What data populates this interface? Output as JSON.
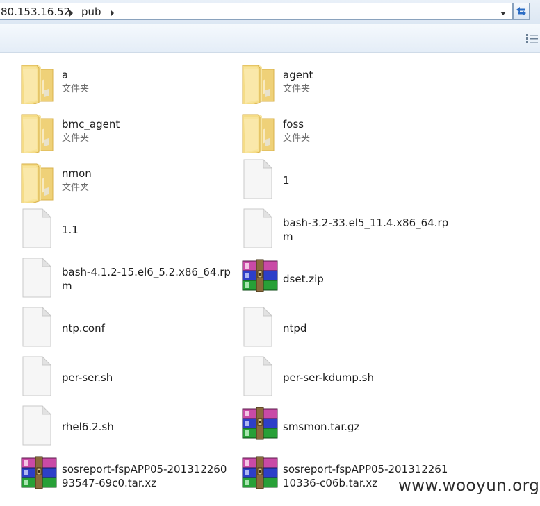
{
  "address_bar": {
    "segments": [
      "80.153.16.52",
      "pub"
    ]
  },
  "colors": {
    "folder": "#f2d56f",
    "archive_pink": "#d74fb0",
    "archive_blue": "#2f3fd0",
    "archive_green": "#2aa43a"
  },
  "items": [
    {
      "name": "a",
      "type": "文件夹",
      "icon": "folder-icon"
    },
    {
      "name": "agent",
      "type": "文件夹",
      "icon": "folder-icon"
    },
    {
      "name": "bmc_agent",
      "type": "文件夹",
      "icon": "folder-icon"
    },
    {
      "name": "foss",
      "type": "文件夹",
      "icon": "folder-icon"
    },
    {
      "name": "nmon",
      "type": "文件夹",
      "icon": "folder-icon"
    },
    {
      "name": "1",
      "type": "",
      "icon": "file-icon"
    },
    {
      "name": "1.1",
      "type": "",
      "icon": "file-icon"
    },
    {
      "name": "bash-3.2-33.el5_11.4.x86_64.rpm",
      "type": "",
      "icon": "file-icon"
    },
    {
      "name": "bash-4.1.2-15.el6_5.2.x86_64.rpm",
      "type": "",
      "icon": "file-icon"
    },
    {
      "name": "dset.zip",
      "type": "",
      "icon": "archive-icon"
    },
    {
      "name": "ntp.conf",
      "type": "",
      "icon": "file-icon"
    },
    {
      "name": "ntpd",
      "type": "",
      "icon": "file-icon"
    },
    {
      "name": "per-ser.sh",
      "type": "",
      "icon": "file-icon"
    },
    {
      "name": "per-ser-kdump.sh",
      "type": "",
      "icon": "file-icon"
    },
    {
      "name": "rhel6.2.sh",
      "type": "",
      "icon": "file-icon"
    },
    {
      "name": "smsmon.tar.gz",
      "type": "",
      "icon": "archive-icon"
    },
    {
      "name": "sosreport-fspAPP05-20131226093547-69c0.tar.xz",
      "type": "",
      "icon": "archive-icon"
    },
    {
      "name": "sosreport-fspAPP05-20131226110336-c06b.tar.xz",
      "type": "",
      "icon": "archive-icon"
    }
  ],
  "watermark": "www.wooyun.org"
}
